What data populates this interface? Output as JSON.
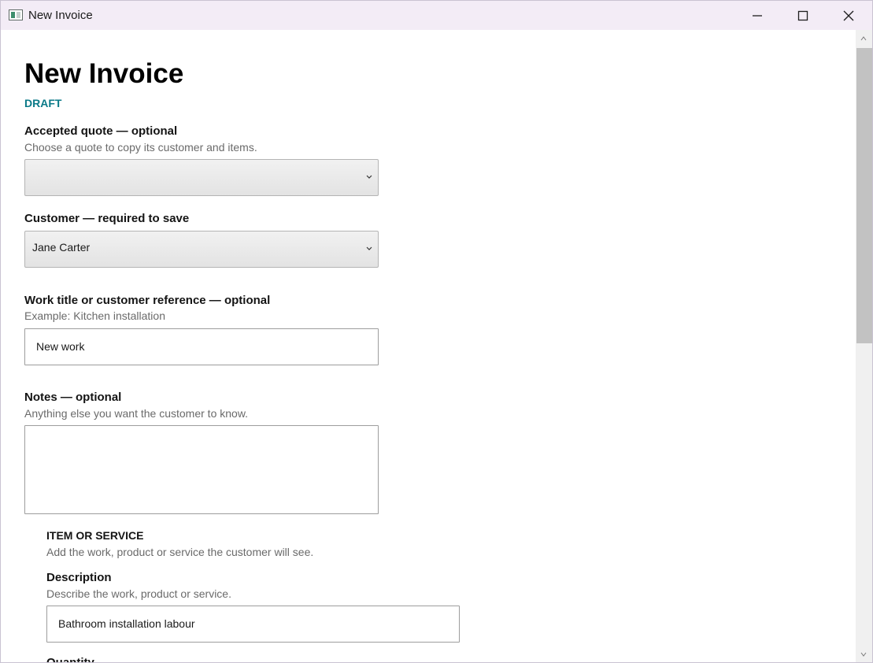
{
  "window": {
    "title": "New Invoice"
  },
  "page": {
    "title": "New Invoice",
    "status": "DRAFT"
  },
  "form": {
    "accepted_quote": {
      "label": "Accepted quote — optional",
      "help": "Choose a quote to copy its customer and items.",
      "value": ""
    },
    "customer": {
      "label": "Customer — required to save",
      "value": "Jane Carter"
    },
    "work_title": {
      "label": "Work title or customer reference — optional",
      "help": "Example: Kitchen installation",
      "value": "New work"
    },
    "notes": {
      "label": "Notes — optional",
      "help": "Anything else you want the customer to know.",
      "value": ""
    }
  },
  "item": {
    "heading": "ITEM OR SERVICE",
    "help": "Add the work, product or service the customer will see.",
    "description": {
      "label": "Description",
      "help": "Describe the work, product or service.",
      "value": "Bathroom installation labour"
    },
    "quantity_label_partial": "Quantity"
  },
  "icons": {
    "app": "app-window-icon",
    "minimize": "minimize-icon",
    "maximize": "maximize-icon",
    "close": "close-icon",
    "dropdown": "chevron-down-icon",
    "scroll_up": "scroll-up-arrow-icon",
    "scroll_down": "scroll-down-arrow-icon"
  },
  "colors": {
    "titlebar": "#f3ecf6",
    "status": "#0b7a88",
    "help_text": "#6a6a6a",
    "scrollbar_thumb": "#c2c2c2"
  }
}
